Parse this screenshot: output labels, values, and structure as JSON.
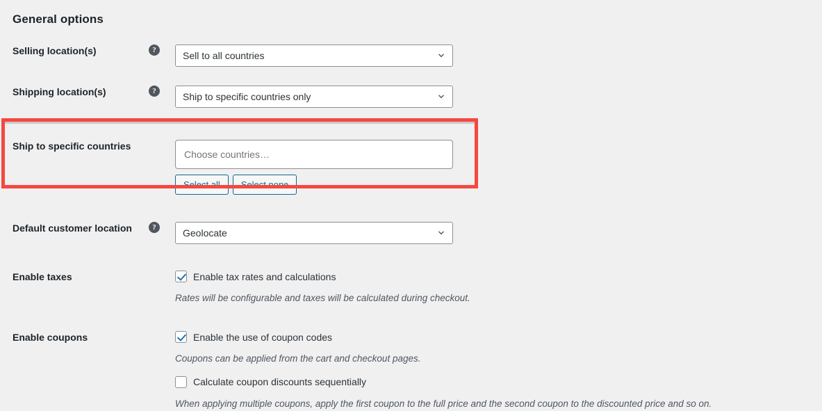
{
  "page": {
    "title": "General options",
    "background_color": "#f0f0f1",
    "highlight_color": "#f4493f",
    "link_color": "#0a6b8e"
  },
  "rows": {
    "selling_location": {
      "label": "Selling location(s)",
      "help_icon": "question-mark-icon",
      "select_value": "Sell to all countries",
      "chevron_icon": "chevron-down-icon"
    },
    "shipping_location": {
      "label": "Shipping location(s)",
      "help_icon": "question-mark-icon",
      "select_value": "Ship to specific countries only",
      "chevron_icon": "chevron-down-icon"
    },
    "ship_to_specific_countries": {
      "label": "Ship to specific countries",
      "input_value": "",
      "input_placeholder": "Choose countries…",
      "select_all_label": "Select all",
      "select_none_label": "Select none",
      "highlighted": true
    },
    "default_customer_location": {
      "label": "Default customer location",
      "help_icon": "question-mark-icon",
      "select_value": "Geolocate",
      "chevron_icon": "chevron-down-icon"
    },
    "enable_taxes": {
      "label": "Enable taxes",
      "checkbox_label": "Enable tax rates and calculations",
      "checked": true,
      "description": "Rates will be configurable and taxes will be calculated during checkout."
    },
    "enable_coupons": {
      "label": "Enable coupons",
      "checkbox_label": "Enable the use of coupon codes",
      "checked": true,
      "description": "Coupons can be applied from the cart and checkout pages.",
      "secondary_checkbox_label": "Calculate coupon discounts sequentially",
      "secondary_checked": false,
      "secondary_description": "When applying multiple coupons, apply the first coupon to the full price and the second coupon to the discounted price and so on."
    }
  }
}
